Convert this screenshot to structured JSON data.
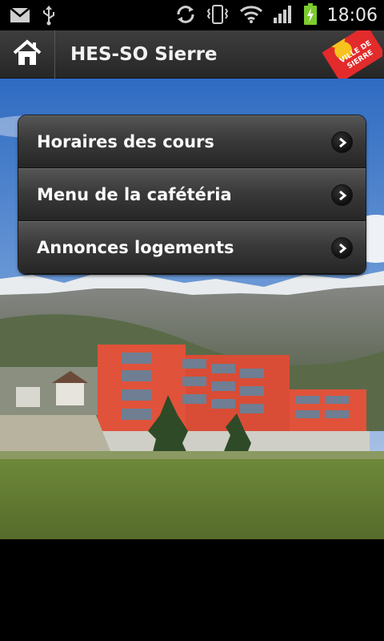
{
  "status_bar": {
    "time": "18:06",
    "icons": [
      "gmail-icon",
      "usb-icon",
      "sync-icon",
      "vibrate-icon",
      "wifi-icon",
      "signal-icon",
      "battery-charging-icon"
    ]
  },
  "action_bar": {
    "title": "HES-SO Sierre",
    "home_icon": "home-icon",
    "logo_text_line1": "VILLE DE",
    "logo_text_line2": "SIERRE"
  },
  "menu": {
    "items": [
      {
        "label": "Horaires des cours"
      },
      {
        "label": "Menu de la cafétéria"
      },
      {
        "label": "Annonces logements"
      }
    ]
  },
  "colors": {
    "building_red": "#e0523a",
    "logo_red": "#e32b2b",
    "logo_yellow": "#f7c21d",
    "battery_green": "#7ccb2e"
  }
}
